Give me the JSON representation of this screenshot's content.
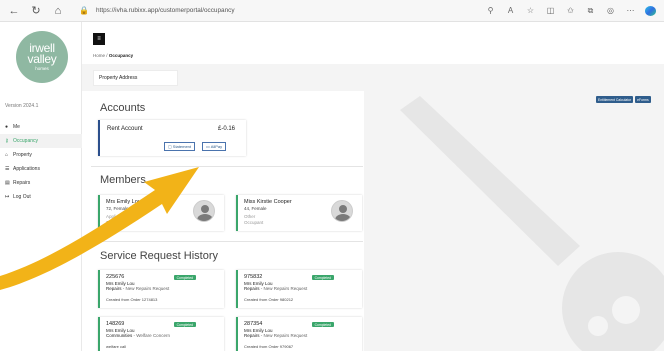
{
  "browser": {
    "url": "https://ivha.rubixx.app/customerportal/occupancy"
  },
  "sidebar": {
    "logo": {
      "line1": "irwell",
      "line2": "valley",
      "line3": "homes"
    },
    "version": "Version 2024.1",
    "items": [
      {
        "label": "Me",
        "icon": "person-icon"
      },
      {
        "label": "Occupancy",
        "icon": "key-icon",
        "active": true
      },
      {
        "label": "Property",
        "icon": "home-icon"
      },
      {
        "label": "Applications",
        "icon": "list-icon"
      },
      {
        "label": "Repairs",
        "icon": "wrench-icon"
      },
      {
        "label": "Log Out",
        "icon": "logout-icon"
      }
    ]
  },
  "header": {
    "breadcrumb_home": "Home",
    "breadcrumb_sep": "/",
    "breadcrumb_current": "Occupancy",
    "property_address_label": "Property Address"
  },
  "right_buttons": {
    "entitlement": "Entitlement Calculator",
    "eforms": "eForms"
  },
  "accounts": {
    "heading": "Accounts",
    "rent_title": "Rent Account",
    "rent_amount": "£-0.16",
    "statement_label": "Statement",
    "allpay_label": "AllPay"
  },
  "members": {
    "heading": "Members",
    "list": [
      {
        "name": "Mrs Emily Lou",
        "info": "72, Female",
        "role1": "Applicant",
        "role2": "Tenant"
      },
      {
        "name": "Miss Kirstie Cooper",
        "info": "44, Female",
        "role1": "Other",
        "role2": "Occupant"
      }
    ]
  },
  "service_requests": {
    "heading": "Service Request History",
    "list": [
      {
        "number": "225676",
        "status": "Completed",
        "person": "Mrs Emily Lou",
        "category": "Repairs",
        "subtype": " - New Repairs Request",
        "note": "Created from Order 1274813"
      },
      {
        "number": "975832",
        "status": "Completed",
        "person": "Mrs Emily Lou",
        "category": "Repairs",
        "subtype": " - New Repairs Request",
        "note": "Created from Order 980212"
      },
      {
        "number": "148269",
        "status": "Completed",
        "person": "Mrs Emily Lou",
        "category": "Communities",
        "subtype": " - Welfare Concern",
        "note": "welfare call"
      },
      {
        "number": "287354",
        "status": "Completed",
        "person": "Mrs Emily Lou",
        "category": "Repairs",
        "subtype": " - New Repairs Request",
        "note": "Created from Order 979067"
      }
    ]
  },
  "colors": {
    "accent_green": "#3aa66b",
    "accent_blue": "#2b4f8c",
    "arrow_yellow": "#f2b318"
  }
}
